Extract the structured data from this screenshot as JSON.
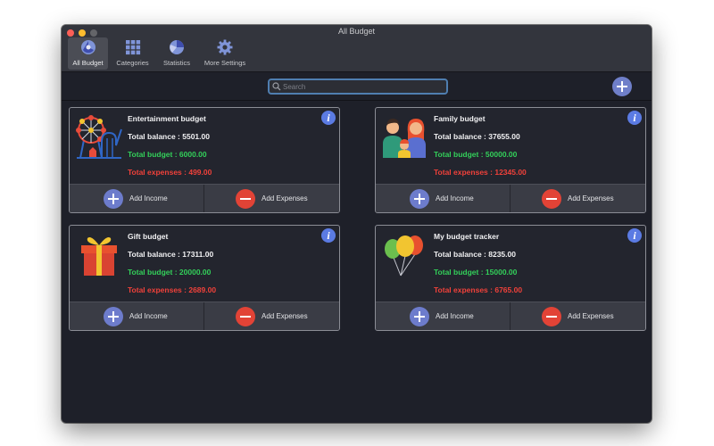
{
  "window": {
    "title": "All Budget"
  },
  "tabs": [
    {
      "label": "All Budget",
      "icon": "all-budget-icon",
      "active": true
    },
    {
      "label": "Categories",
      "icon": "categories-grid-icon",
      "active": false
    },
    {
      "label": "Statistics",
      "icon": "statistics-icon",
      "active": false
    },
    {
      "label": "More Settings",
      "icon": "gear-icon",
      "active": false
    }
  ],
  "search": {
    "placeholder": "Search",
    "value": ""
  },
  "budgets": [
    {
      "name": "Entertainment budget",
      "balance": "Total balance : 5501.00",
      "budget": "Total budget : 6000.00",
      "expenses": "Total expenses : 499.00",
      "icon": "ferris-wheel-icon"
    },
    {
      "name": "Family budget",
      "balance": "Total balance : 37655.00",
      "budget": "Total budget : 50000.00",
      "expenses": "Total expenses : 12345.00",
      "icon": "family-icon"
    },
    {
      "name": "Gift budget",
      "balance": "Total balance : 17311.00",
      "budget": "Total budget : 20000.00",
      "expenses": "Total expenses : 2689.00",
      "icon": "gift-icon"
    },
    {
      "name": "My budget tracker",
      "balance": "Total balance : 8235.00",
      "budget": "Total budget : 15000.00",
      "expenses": "Total expenses : 6765.00",
      "icon": "balloons-icon"
    }
  ],
  "actions": {
    "add_income": "Add Income",
    "add_expenses": "Add Expenses",
    "info_glyph": "i"
  },
  "colors": {
    "budget_text": "#33d05a",
    "expense_text": "#f0413a",
    "info_blue": "#5b7be3",
    "income_circle": "#6d7ccc",
    "expense_circle": "#e24336"
  }
}
